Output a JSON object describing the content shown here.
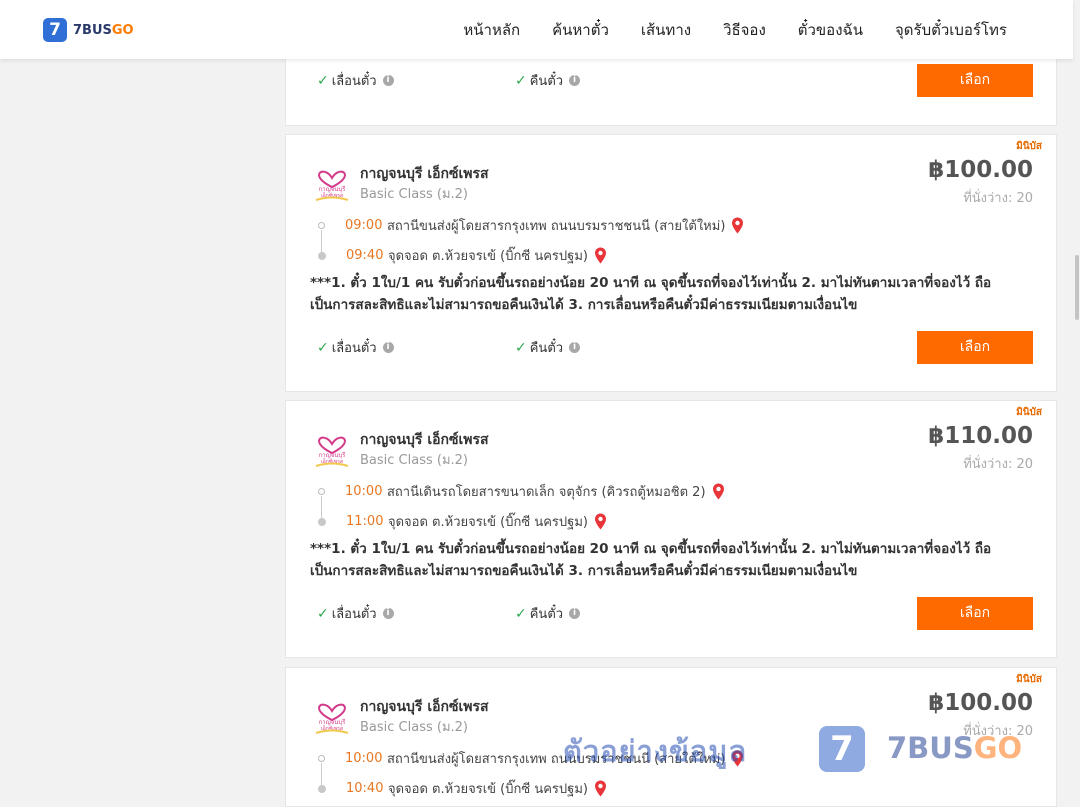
{
  "brand": {
    "logo_mark": "7",
    "name_part1": "7BUS",
    "name_part2": "GO"
  },
  "nav": [
    {
      "label": "หน้าหลัก"
    },
    {
      "label": "ค้นหาตั๋ว"
    },
    {
      "label": "เส้นทาง"
    },
    {
      "label": "วิธีจอง"
    },
    {
      "label": "ตั๋วของฉัน"
    },
    {
      "label": "จุดรับตั๋วเบอร์โทร"
    }
  ],
  "common": {
    "reschedule_label": "เลื่อนตั๋ว",
    "refund_label": "คืนตั๋ว",
    "select_label": "เลือก",
    "check_icon": "check-icon",
    "info_icon": "info-icon",
    "pin_icon": "map-pin-icon",
    "accent_color": "#ff6a00"
  },
  "cards": [
    {
      "bus_type": "มินิบัส",
      "operator": "กาญจนบุรี เอ็กซ์เพรส",
      "class": "Basic Class (ม.2)",
      "price": "฿100.00",
      "seats": "ที่นั่งว่าง: 20",
      "stops": [
        {
          "time": "09:00",
          "name": "สถานีขนส่งผู้โดยสารกรุงเทพ ถนนบรมราชชนนี (สายใต้ใหม่)"
        },
        {
          "time": "09:40",
          "name": "จุดจอด ต.ห้วยจรเข้ (บิ๊กซี นครปฐม)"
        }
      ],
      "note": "***1. ตั๋ว 1ใบ/1 คน รับตั๋วก่อนขึ้นรถอย่างน้อย 20 นาที ณ จุดขึ้นรถที่จองไว้เท่านั้น 2. มาไม่ทันตามเวลาที่จองไว้ ถือเป็นการสละสิทธิและไม่สามารถขอคืนเงินได้ 3. การเลื่อนหรือคืนตั๋วมีค่าธรรมเนียมตามเงื่อนไข"
    },
    {
      "bus_type": "มินิบัส",
      "operator": "กาญจนบุรี เอ็กซ์เพรส",
      "class": "Basic Class (ม.2)",
      "price": "฿110.00",
      "seats": "ที่นั่งว่าง: 20",
      "stops": [
        {
          "time": "10:00",
          "name": "สถานีเดินรถโดยสารขนาดเล็ก จตุจักร (คิวรถตู้หมอชิต 2)"
        },
        {
          "time": "11:00",
          "name": "จุดจอด ต.ห้วยจรเข้ (บิ๊กซี นครปฐม)"
        }
      ],
      "note": "***1. ตั๋ว 1ใบ/1 คน รับตั๋วก่อนขึ้นรถอย่างน้อย 20 นาที ณ จุดขึ้นรถที่จองไว้เท่านั้น 2. มาไม่ทันตามเวลาที่จองไว้ ถือเป็นการสละสิทธิและไม่สามารถขอคืนเงินได้ 3. การเลื่อนหรือคืนตั๋วมีค่าธรรมเนียมตามเงื่อนไข"
    },
    {
      "bus_type": "มินิบัส",
      "operator": "กาญจนบุรี เอ็กซ์เพรส",
      "class": "Basic Class (ม.2)",
      "price": "฿100.00",
      "seats": "ที่นั่งว่าง: 20",
      "stops": [
        {
          "time": "10:00",
          "name": "สถานีขนส่งผู้โดยสารกรุงเทพ ถนนบรมราชชนนี (สายใต้ใหม่)"
        },
        {
          "time": "10:40",
          "name": "จุดจอด ต.ห้วยจรเข้ (บิ๊กซี นครปฐม)"
        }
      ]
    }
  ],
  "watermark": {
    "text": "ตัวอย่างข้อมูล",
    "logo_mark": "7",
    "brand_part1": "7BUS",
    "brand_part2": "GO"
  }
}
